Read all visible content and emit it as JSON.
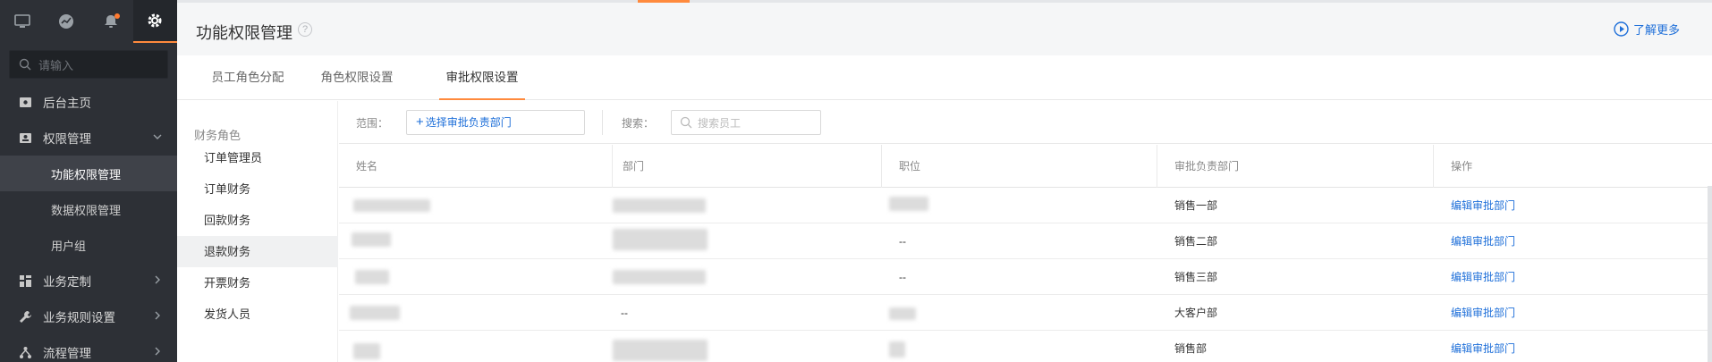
{
  "sidebar": {
    "top_icons": [
      {
        "name": "monitor-icon"
      },
      {
        "name": "trend-icon"
      },
      {
        "name": "bell-icon"
      },
      {
        "name": "gear-icon"
      }
    ],
    "search_placeholder": "请输入",
    "items": [
      {
        "label": "后台主页",
        "icon": "home-icon"
      },
      {
        "label": "权限管理",
        "icon": "user-card-icon",
        "expanded": true
      },
      {
        "label": "功能权限管理",
        "sub": true,
        "active": true
      },
      {
        "label": "数据权限管理",
        "sub": true
      },
      {
        "label": "用户组",
        "sub": true
      },
      {
        "label": "业务定制",
        "icon": "grid-icon"
      },
      {
        "label": "业务规则设置",
        "icon": "wrench-icon"
      },
      {
        "label": "流程管理",
        "icon": "flow-icon"
      }
    ]
  },
  "header": {
    "title": "功能权限管理",
    "help": "?",
    "learn_more": "了解更多"
  },
  "tabs": [
    {
      "label": "员工角色分配"
    },
    {
      "label": "角色权限设置"
    },
    {
      "label": "审批权限设置",
      "active": true
    }
  ],
  "roles": {
    "heading": "财务角色",
    "items": [
      "订单管理员",
      "订单财务",
      "回款财务",
      "退款财务",
      "开票财务",
      "发货人员"
    ],
    "active_index": 3
  },
  "filter": {
    "scope_label": "范围：",
    "dept_button": "选择审批负责部门",
    "search_label": "搜索：",
    "search_placeholder": "搜索员工"
  },
  "table": {
    "headers": [
      "姓名",
      "部门",
      "职位",
      "审批负责部门",
      "操作"
    ],
    "rows": [
      {
        "dept": "",
        "position": "",
        "approval_dept": "销售一部",
        "action": "编辑审批部门"
      },
      {
        "dept": "",
        "position": "--",
        "approval_dept": "销售二部",
        "action": "编辑审批部门"
      },
      {
        "dept": "",
        "position": "--",
        "approval_dept": "销售三部",
        "action": "编辑审批部门"
      },
      {
        "dept": "--",
        "position": "",
        "approval_dept": "大客户部",
        "action": "编辑审批部门"
      },
      {
        "dept": "",
        "position": "",
        "approval_dept": "销售部",
        "action": "编辑审批部门"
      }
    ]
  },
  "colors": {
    "accent": "#ff8a3d",
    "link": "#1e6fd9",
    "sidebar_bg": "#2d3036"
  }
}
